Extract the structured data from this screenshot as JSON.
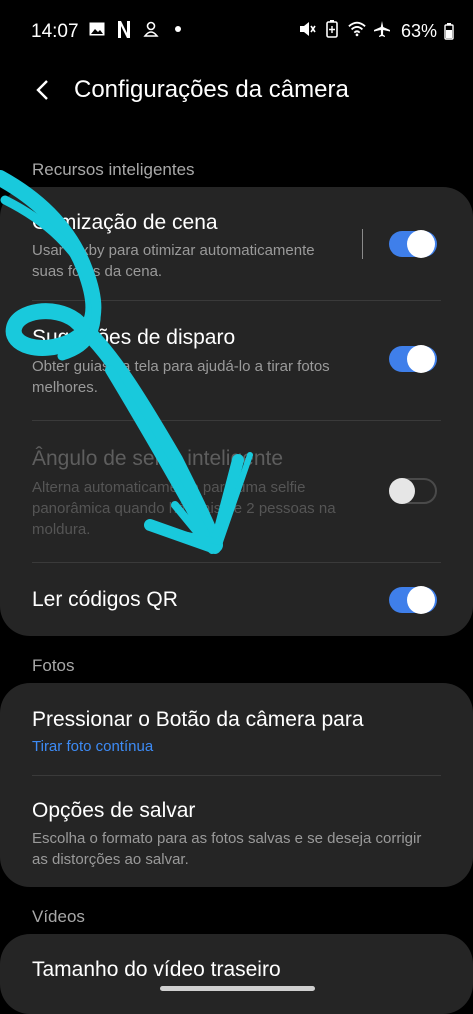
{
  "status_bar": {
    "time": "14:07",
    "battery": "63%",
    "left_icons": [
      "gallery-icon",
      "netflix-icon",
      "notification-icon",
      "dot-icon"
    ],
    "right_icons": [
      "mute-icon",
      "battery-saver-icon",
      "wifi-icon",
      "airplane-icon",
      "battery-icon"
    ]
  },
  "header": {
    "title": "Configurações da câmera"
  },
  "sections": {
    "smart": {
      "label": "Recursos inteligentes",
      "items": [
        {
          "title": "Otimização de cena",
          "subtitle": "Usar Bixby para otimizar automaticamente suas fotos da cena.",
          "toggle": true,
          "enabled": true
        },
        {
          "title": "Sugestões de disparo",
          "subtitle": "Obter guias na tela para ajudá-lo a tirar fotos melhores.",
          "toggle": true,
          "enabled": true
        },
        {
          "title": "Ângulo de selfie inteligente",
          "subtitle": "Alterna automaticamente para uma selfie panorâmica quando há mais de 2 pessoas na moldura.",
          "toggle": false,
          "enabled": false
        },
        {
          "title": "Ler códigos QR",
          "toggle": true,
          "enabled": true
        }
      ]
    },
    "photos": {
      "label": "Fotos",
      "items": [
        {
          "title": "Pressionar o Botão da câmera para",
          "subtitle": "Tirar foto contínua"
        },
        {
          "title": "Opções de salvar",
          "subtitle": "Escolha o formato para as fotos salvas e se deseja corrigir as distorções ao salvar."
        }
      ]
    },
    "videos": {
      "label": "Vídeos",
      "items": [
        {
          "title": "Tamanho do vídeo traseiro"
        }
      ]
    }
  },
  "colors": {
    "background": "#000000",
    "card": "#252525",
    "accent": "#3f7fea",
    "link": "#3d8bf5",
    "annotation": "#19c9dc"
  }
}
